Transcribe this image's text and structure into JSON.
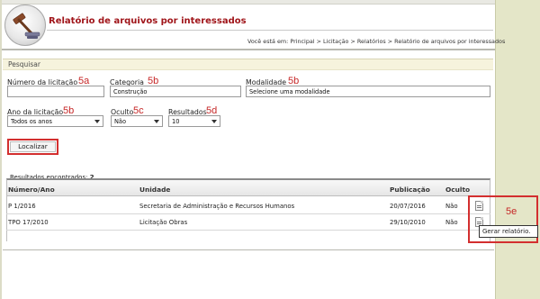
{
  "header": {
    "title": "Relatório de arquivos por interessados",
    "logo_icon": "gavel-logo-icon"
  },
  "breadcrumb": {
    "prefix": "Você está em:",
    "items": [
      "Principal",
      "Licitação",
      "Relatórios",
      "Relatório de arquivos por interessados"
    ],
    "separator": ">"
  },
  "search": {
    "section_label": "Pesquisar",
    "fields": {
      "numero": {
        "label": "Número da licitação",
        "badge": "5a",
        "value": ""
      },
      "categoria": {
        "label": "Categoria",
        "badge": "5b",
        "value": "Construção"
      },
      "modalidade": {
        "label": "Modalidade",
        "badge": "5b",
        "value": "Selecione uma modalidade"
      },
      "ano": {
        "label": "Ano da licitação",
        "badge": "5b",
        "value": "Todos os anos"
      },
      "oculto": {
        "label": "Oculto",
        "badge": "5c",
        "value": "Não"
      },
      "resultados": {
        "label": "Resultados",
        "badge": "5d",
        "value": "10"
      }
    },
    "submit_label": "Localizar"
  },
  "results": {
    "count_label": "Resultados encontrados:",
    "count": "2",
    "columns": [
      "Número/Ano",
      "Unidade",
      "Publicação",
      "Oculto"
    ],
    "rows": [
      {
        "numero": "P 1/2016",
        "unidade": "Secretaria de Administração e Recursos Humanos",
        "publicacao": "20/07/2016",
        "oculto": "Não"
      },
      {
        "numero": "TPO 17/2010",
        "unidade": "Licitação Obras",
        "publicacao": "29/10/2010",
        "oculto": "Não"
      }
    ]
  },
  "annotation": {
    "report_badge": "5e",
    "tooltip": "Gerar relatório."
  },
  "colors": {
    "title_red": "#a0151a",
    "highlight_red": "#d32f2f",
    "search_bar_bg": "#f6f3dd",
    "side_panel": "#e4e6c8"
  }
}
